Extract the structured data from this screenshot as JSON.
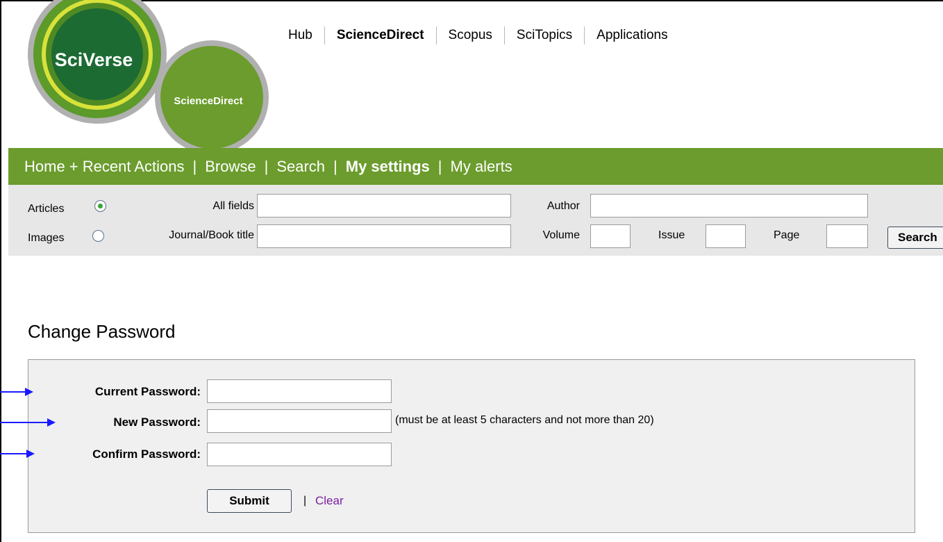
{
  "logo": {
    "main_text": "SciVerse",
    "sub_text": "ScienceDirect"
  },
  "top_nav": [
    "Hub",
    "ScienceDirect",
    "Scopus",
    "SciTopics",
    "Applications"
  ],
  "main_nav": [
    "Home + Recent Actions",
    "Browse",
    "Search",
    "My settings",
    "My alerts"
  ],
  "main_nav_separator": "|",
  "quick_search": {
    "articles_label": "Articles",
    "images_label": "Images",
    "all_fields_label": "All fields",
    "journal_label": "Journal/Book title",
    "author_label": "Author",
    "volume_label": "Volume",
    "issue_label": "Issue",
    "page_label": "Page",
    "search_button": "Search",
    "selected": "Articles"
  },
  "change_password": {
    "title": "Change Password",
    "current_label": "Current Password:",
    "new_label": "New Password:",
    "confirm_label": "Confirm Password:",
    "hint": "(must be at least 5 characters and not more than 20)",
    "submit_label": "Submit",
    "separator": "|",
    "clear_label": "Clear"
  },
  "colors": {
    "green": "#6b9c2d",
    "search_band": "#e7e7e7",
    "panel": "#f0f0f0",
    "arrow": "#1a1aff",
    "link": "#7a1fa0"
  }
}
